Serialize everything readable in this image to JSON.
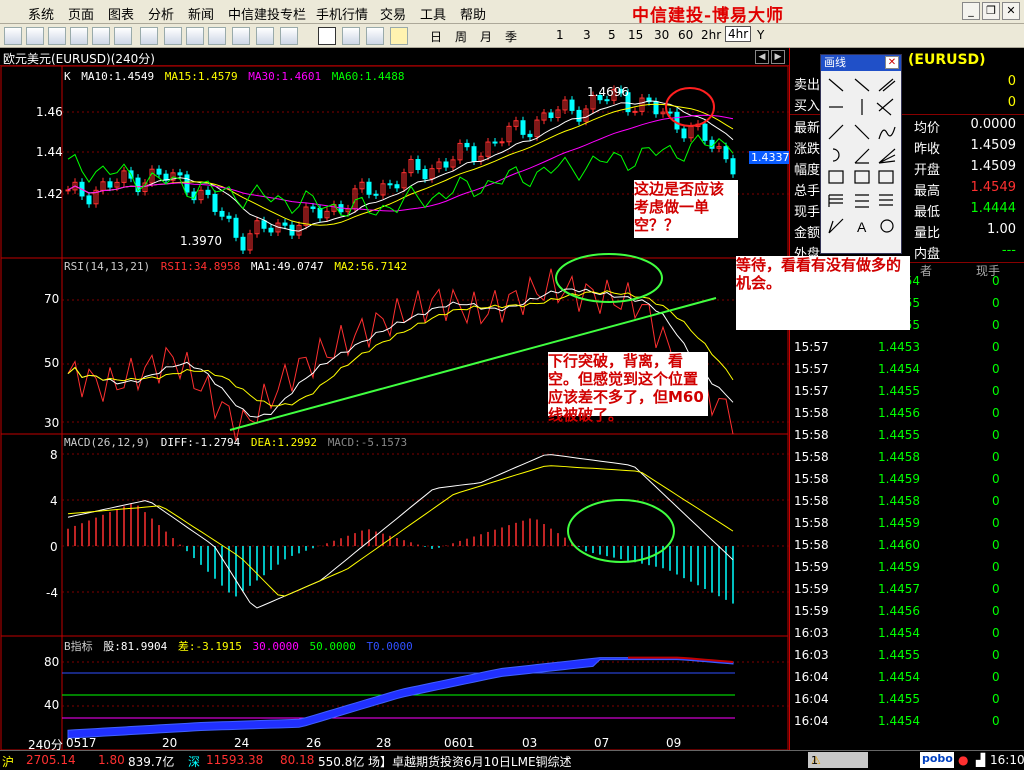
{
  "menu": [
    "系统",
    "页面",
    "图表",
    "分析",
    "新闻",
    "中信建投专栏",
    "手机行情",
    "交易",
    "工具",
    "帮助"
  ],
  "brand": "中信建投-博易大师",
  "toolbar": {
    "periods": [
      "日",
      "周",
      "月",
      "季",
      "1",
      "3",
      "5",
      "15",
      "30",
      "60",
      "2hr",
      "4hr",
      "Y"
    ],
    "selected_period": "4hr"
  },
  "chart": {
    "title": "欧元美元(EURUSD)(240分)",
    "period_label": "240分",
    "price_legend": {
      "k": "K",
      "ma10": "MA10:1.4549",
      "ma15": "MA15:1.4579",
      "ma30": "MA30:1.4601",
      "ma60": "MA60:1.4488"
    },
    "price_ticks": [
      "1.46",
      "1.44",
      "1.42"
    ],
    "high_label": "1.4696",
    "low_label": "1.3970",
    "current_price": "1.4337",
    "rsi_legend": {
      "name": "RSI(14,13,21)",
      "rsi1": "RSI1:34.8958",
      "ma1": "MA1:49.0747",
      "ma2": "MA2:56.7142"
    },
    "rsi_ticks": [
      "70",
      "50",
      "30"
    ],
    "macd_legend": {
      "name": "MACD(26,12,9)",
      "diff": "DIFF:-1.2794",
      "dea": "DEA:1.2992",
      "macd": "MACD:-5.1573"
    },
    "macd_ticks": [
      "8",
      "4",
      "0",
      "-4"
    ],
    "b_legend": {
      "name": "B指标",
      "gu": "股:81.9904",
      "cha": "差:-3.1915",
      "v30": "30.0000",
      "v50": "50.0000",
      "t0": "T0.0000"
    },
    "b_ticks": [
      "80",
      "40"
    ],
    "dates": [
      "0517",
      "20",
      "24",
      "26",
      "28",
      "0601",
      "03",
      "07",
      "09"
    ]
  },
  "annotations": {
    "a1": "这边是否应该考虑做一单空？？",
    "a2": "等待，看看有没有做多的机会。",
    "a3": "下行突破，背离，看空。但感觉到这个位置应该差不多了，但M60线被破了。"
  },
  "drawpanel": {
    "title": "画线",
    "text_tool": "A"
  },
  "quote": {
    "symbol": "(EURUSD)",
    "sell_label": "卖出",
    "sell_value": "0",
    "buy_label": "买入",
    "buy_value": "0",
    "latest_label": "最新",
    "avg_label": "均价",
    "avg_value": "0.0000",
    "change_label": "涨跌",
    "prev_close_label": "昨收",
    "prev_close_value": "1.4509",
    "range_label": "幅度",
    "open_label": "开盘",
    "open_value": "1.4509",
    "total_label": "总手",
    "high_label": "最高",
    "high_value": "1.4549",
    "now_label": "现手",
    "low_label": "最低",
    "low_value": "1.4444",
    "amount_label": "金额",
    "ratio_label": "量比",
    "ratio_value": "1.00",
    "outer_label": "外盘",
    "inner_label": "内盘",
    "inner_value": "---",
    "col_header_last": "现手"
  },
  "trades": [
    {
      "time": "",
      "price": "1.4454",
      "vol": "0"
    },
    {
      "time": "",
      "price": "1.4455",
      "vol": "0"
    },
    {
      "time": "15:57",
      "price": "1.4455",
      "vol": "0"
    },
    {
      "time": "15:57",
      "price": "1.4453",
      "vol": "0"
    },
    {
      "time": "15:57",
      "price": "1.4454",
      "vol": "0"
    },
    {
      "time": "15:57",
      "price": "1.4455",
      "vol": "0"
    },
    {
      "time": "15:58",
      "price": "1.4456",
      "vol": "0"
    },
    {
      "time": "15:58",
      "price": "1.4455",
      "vol": "0"
    },
    {
      "time": "15:58",
      "price": "1.4458",
      "vol": "0"
    },
    {
      "time": "15:58",
      "price": "1.4459",
      "vol": "0"
    },
    {
      "time": "15:58",
      "price": "1.4458",
      "vol": "0"
    },
    {
      "time": "15:58",
      "price": "1.4459",
      "vol": "0"
    },
    {
      "time": "15:58",
      "price": "1.4460",
      "vol": "0"
    },
    {
      "time": "15:59",
      "price": "1.4459",
      "vol": "0"
    },
    {
      "time": "15:59",
      "price": "1.4457",
      "vol": "0"
    },
    {
      "time": "15:59",
      "price": "1.4456",
      "vol": "0"
    },
    {
      "time": "16:03",
      "price": "1.4454",
      "vol": "0"
    },
    {
      "time": "16:03",
      "price": "1.4455",
      "vol": "0"
    },
    {
      "time": "16:04",
      "price": "1.4454",
      "vol": "0"
    },
    {
      "time": "16:04",
      "price": "1.4455",
      "vol": "0"
    },
    {
      "time": "16:04",
      "price": "1.4454",
      "vol": "0"
    }
  ],
  "status": {
    "sh_label": "沪",
    "sh_index": "2705.14",
    "sh_change": "1.80",
    "sh_amount": "839.7亿",
    "sz_label": "深",
    "sz_index": "11593.38",
    "sz_change": "80.18",
    "sz_amount": "550.8亿",
    "news": "场】卓越期货投资6月10日LME铜综述",
    "alert": "1",
    "pobo": "pobo",
    "clock": "16:10"
  },
  "colors": {
    "up": "#ff3030",
    "down": "#00ffff",
    "ma10": "#ffffff",
    "ma15": "#ffff00",
    "ma30": "#ff00ff",
    "ma60": "#00ff00",
    "grid": "#800000"
  }
}
